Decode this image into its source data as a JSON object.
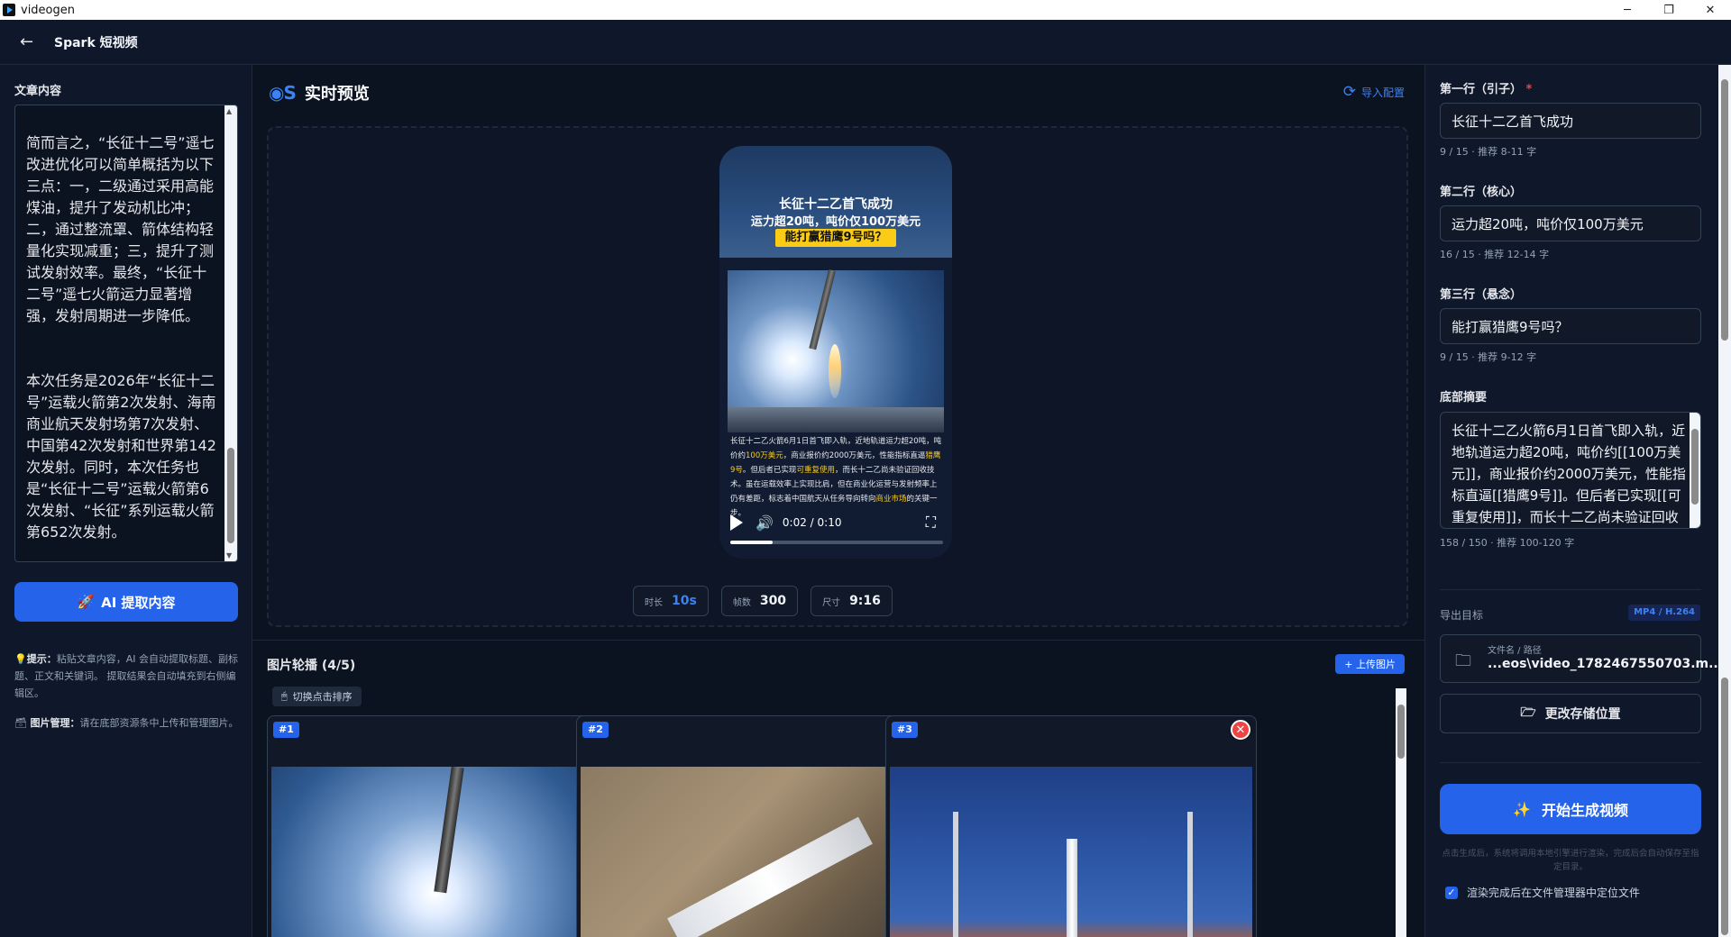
{
  "window": {
    "title": "videogen",
    "minimize": "─",
    "maximize": "❐",
    "close": "✕"
  },
  "header": {
    "back_icon": "←",
    "title": "Spark 短视频"
  },
  "left": {
    "label": "文章内容",
    "article": "简而言之，“长征十二号”遥七改进优化可以简单概括为以下三点：一，二级通过采用高能煤油，提升了发动机比冲；二，通过整流罩、箭体结构轻量化实现减重；三，提升了测试发射效率。最终，“长征十二号”遥七火箭运力显著增强，发射周期进一步降低。\n\n\n本次任务是2026年“长征十二号”运载火箭第2次发射、海南商业航天发射场第7次发射、中国第42次发射和世界第142次发射。同时，本次任务也是“长征十二号”运载火箭第6次发射、“长征”系列运载火箭第652次发射。",
    "ai_button": "AI 提取内容",
    "ai_icon": "🚀",
    "tip1_icon": "💡",
    "tip1_title": "提示：",
    "tip1_text": "粘贴文章内容，AI 会自动提取标题、副标题、正文和关键词。 提取结果会自动填充到右侧编辑区。",
    "tip2_icon": "🗃",
    "tip2_title": "图片管理：",
    "tip2_text": "请在底部资源条中上传和管理图片。"
  },
  "preview": {
    "title": "实时预览",
    "import_label": "导入配置",
    "phone": {
      "line1": "长征十二乙首飞成功",
      "line2": "运力超20吨，吨价仅100万美元",
      "line3": "能打赢猎鹰9号吗？",
      "summary_a": "长征十二乙火箭6月1日首飞即入轨，近地轨道运力超20吨，吨价约",
      "summary_h1": "100万美元",
      "summary_b": "，商业报价约2000万美元，性能指标直逼",
      "summary_h2": "猎鹰9号",
      "summary_c": "。但后者已实现",
      "summary_h3": "可重复使用",
      "summary_d": "，而长十二乙尚未验证回收技术。虽在运载效率上实现比肩，但在商业化运营与发射频率上仍有差距，标志着中国航天从任务导向转向",
      "summary_h4": "商业市场",
      "summary_e": "的关键一步。",
      "time": "0:02 / 0:10",
      "progress": 0.2
    },
    "chips": [
      {
        "k": "时长",
        "v": "10s"
      },
      {
        "k": "帧数",
        "v": "300"
      },
      {
        "k": "尺寸",
        "v": "9:16"
      }
    ]
  },
  "gallery": {
    "title": "图片轮播 (4/5)",
    "upload": "+ 上传图片",
    "sort": "切换点击排序",
    "sort_icon": "🖱",
    "cards": [
      {
        "num": "#1",
        "del": "✕"
      },
      {
        "num": "#2",
        "del": "✕"
      },
      {
        "num": "#3",
        "del": "✕"
      }
    ]
  },
  "right": {
    "line1_label": "第一行（引子）",
    "line1_value": "长征十二乙首飞成功",
    "line1_hint": "9 / 15 · 推荐 8-11 字",
    "line2_label": "第二行（核心）",
    "line2_value": "运力超20吨，吨价仅100万美元",
    "line2_hint": "16 / 15 · 推荐 12-14 字",
    "line3_label": "第三行（悬念）",
    "line3_value": "能打赢猎鹰9号吗？",
    "line3_hint": "9 / 15 · 推荐 9-12 字",
    "summary_label": "底部摘要",
    "summary_value": "长征十二乙火箭6月1日首飞即入轨，近地轨道运力超20吨，吨价约[[100万美元]]，商业报价约2000万美元，性能指标直逼[[猎鹰9号]]。但后者已实现[[可重复使用]]，而长十二乙尚未验证回收技术。虽在运载效率上实现比肩，但在商业化运",
    "summary_hint": "158 / 150 · 推荐 100-120 字",
    "export_label": "导出目标",
    "export_tag": "MP4 / H.264",
    "file_key": "文件名 / 路径",
    "file_value": "...eos\\video_1782467550703.m...",
    "change_btn": "更改存储位置",
    "generate_btn": "开始生成视频",
    "generate_note": "点击生成后，系统将调用本地引擎进行渲染，完成后会自动保存至指定目录。",
    "checkbox_label": "渲染完成后在文件管理器中定位文件",
    "checkbox_checked": true
  }
}
